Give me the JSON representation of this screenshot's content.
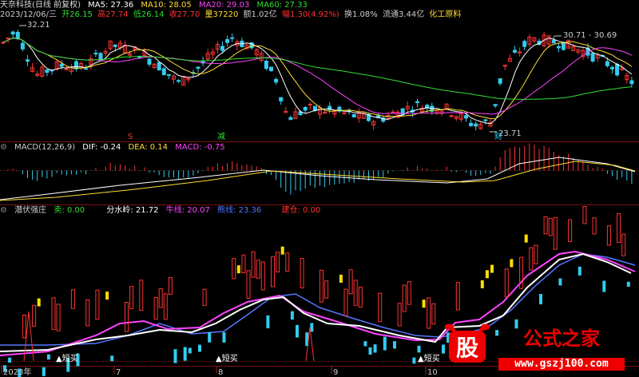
{
  "header": {
    "stock": "天奈科技(日线 前复权)",
    "ma5": "MA5: 27.36",
    "ma10": "MA10: 28.05",
    "ma20": "MA20: 29.03",
    "ma60": "MA60: 27.33",
    "date": "2023/12/06/三",
    "open": "开26.15",
    "high": "高27.74",
    "low": "低26.14",
    "close": "收27.70",
    "vol": "量37220",
    "amount": "额1.02亿",
    "change": "幅1.30(4.92%)",
    "turnover": "换1.08%",
    "float": "流通3.44亿",
    "sector": "化工原料"
  },
  "price_panel": {
    "top_label": "32.21",
    "high_label": "30.71 - 30.69",
    "low_label": "23.71",
    "marker_sell": "S",
    "marker_jian": "减",
    "marker_cai": "财"
  },
  "macd": {
    "name": "MACD(12,26,9)",
    "dif": "DIF: -0.24",
    "dea": "DEA: 0.14",
    "macd": "MACD: -0.75"
  },
  "indicator": {
    "name": "潜伏强庄",
    "sell": "卖: 0.00",
    "water": "分水岭: 21.72",
    "bull": "牛线: 20.07",
    "bear": "熊线: 23.36",
    "position": "建仓: 0.00",
    "buy_label": "▲短买"
  },
  "xaxis": [
    "2023年",
    "7",
    "8",
    "9",
    "10"
  ],
  "watermark": {
    "logo_text": "股",
    "title": "公式之家",
    "url": "www.gszj100.com"
  },
  "colors": {
    "up": "#ff3333",
    "down": "#33ccee",
    "ma5": "#ffffff",
    "ma10": "#ffdd33",
    "ma20": "#ff44ff",
    "ma60": "#33dd33",
    "bull": "#ff44ff",
    "bear": "#5577ff"
  }
}
